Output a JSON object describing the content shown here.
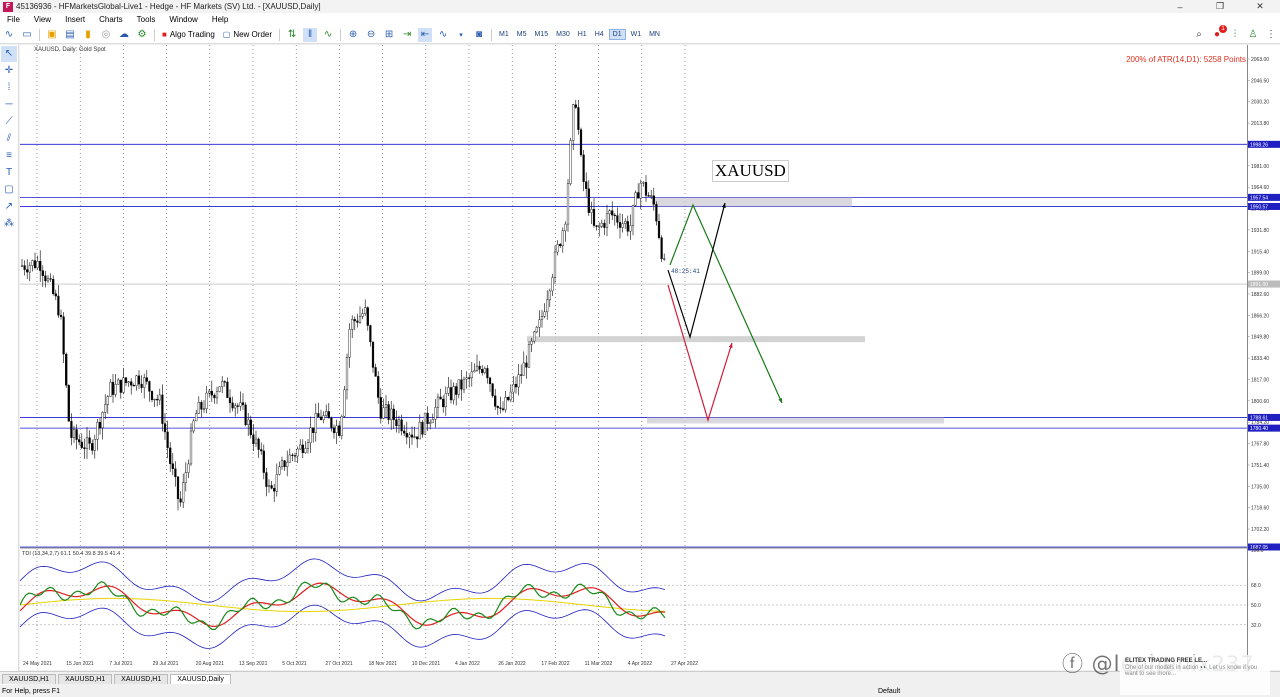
{
  "window": {
    "title": "45136936 - HFMarketsGlobal-Live1 - Hedge - HF Markets (SV) Ltd. - [XAUUSD,Daily]",
    "minimize": "–",
    "restore": "❐",
    "close": "✕"
  },
  "menu": [
    "File",
    "View",
    "Insert",
    "Charts",
    "Tools",
    "Window",
    "Help"
  ],
  "toolbar": {
    "algo_trading": "Algo Trading",
    "new_order": "New Order",
    "timeframes": [
      "M1",
      "M5",
      "M15",
      "M30",
      "H1",
      "H4",
      "D1",
      "W1",
      "MN"
    ],
    "active_timeframe": "D1",
    "notification_count": "1"
  },
  "chart": {
    "title": "XAUUSD, Daily:  Gold Spot",
    "atr_label": "200% of ATR(14,D1): 5258  Points",
    "symbol_box": "XAUUSD",
    "countdown": "48:25:41",
    "tdi_label": "TDI (13,34,2,7) 61.1 50.4 39.8 39.5 41.4",
    "price_ticks": [
      "2063.00",
      "2046.50",
      "2030.20",
      "2013.80",
      "1997.40",
      "1981.00",
      "1964.60",
      "1948.20",
      "1931.80",
      "1915.40",
      "1899.00",
      "1882.60",
      "1866.20",
      "1849.80",
      "1833.40",
      "1817.00",
      "1800.60",
      "1784.20",
      "1767.80",
      "1751.40",
      "1735.00",
      "1718.60",
      "1702.20"
    ],
    "price_tags": [
      "1998.26",
      "1957.54",
      "1950.57",
      "1788.61",
      "1780.40",
      "1891.00",
      "1687.05"
    ],
    "tdi_ticks": [
      "100.0",
      "68.0",
      "50.0",
      "32.0"
    ],
    "dates": [
      "24 May 2021",
      "15 Jun 2021",
      "7 Jul 2021",
      "29 Jul 2021",
      "20 Aug 2021",
      "13 Sep 2021",
      "5 Oct 2021",
      "27 Oct 2021",
      "18 Nov 2021",
      "10 Dec 2021",
      "4 Jan 2022",
      "26 Jan 2022",
      "17 Feb 2022",
      "11 Mar 2022",
      "4 Apr 2022",
      "27 Apr 2022"
    ]
  },
  "tabs": [
    "XAUUSD,H1",
    "XAUUSD,H1",
    "XAUUSD,H1",
    "XAUUSD,Daily"
  ],
  "active_tab": "XAUUSD,Daily",
  "status": {
    "help": "For Help, press F1",
    "profile": "Default"
  },
  "watermark": "ⓕ @lephenix237",
  "notification": {
    "title": "ELITEX TRADING FREE LE...",
    "text": "One of our models in action 👀 Let us know if you want to see more..."
  },
  "colors": {
    "bull_candle": "#000000",
    "bear_candle": "#000000",
    "level_line": "#1f1fd0",
    "green_arrow": "#1a7a1a",
    "red_arrow": "#d01c3c",
    "black_arrow": "#000000",
    "tdi_red": "#e02020",
    "tdi_green": "#1a8a1a",
    "tdi_yellow": "#e8d400",
    "tdi_blue": "#2020c0"
  }
}
